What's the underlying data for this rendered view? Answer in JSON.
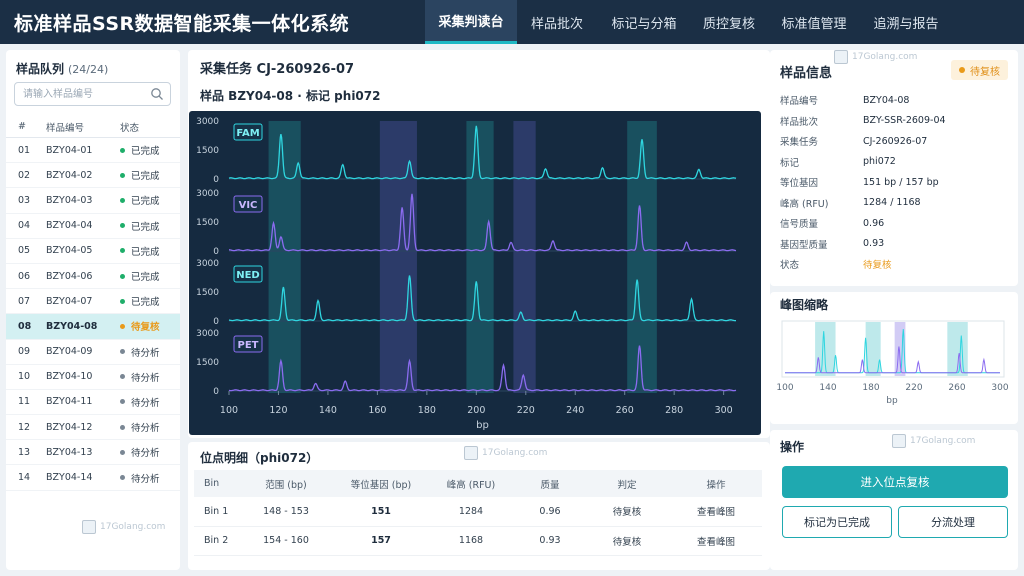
{
  "app": {
    "title": "标准样品SSR数据智能采集一体化系统"
  },
  "nav": [
    {
      "label": "采集判读台",
      "active": true
    },
    {
      "label": "样品批次",
      "active": false
    },
    {
      "label": "标记与分箱",
      "active": false
    },
    {
      "label": "质控复核",
      "active": false
    },
    {
      "label": "标准值管理",
      "active": false
    },
    {
      "label": "追溯与报告",
      "active": false
    }
  ],
  "queue": {
    "title": "样品队列",
    "count": "(24/24)",
    "search_placeholder": "请输入样品编号",
    "columns": [
      "#",
      "样品编号",
      "状态"
    ],
    "rows": [
      {
        "idx": "01",
        "id": "BZY04-01",
        "status": "已完成",
        "color": "#1fae6a"
      },
      {
        "idx": "02",
        "id": "BZY04-02",
        "status": "已完成",
        "color": "#1fae6a"
      },
      {
        "idx": "03",
        "id": "BZY04-03",
        "status": "已完成",
        "color": "#1fae6a"
      },
      {
        "idx": "04",
        "id": "BZY04-04",
        "status": "已完成",
        "color": "#1fae6a"
      },
      {
        "idx": "05",
        "id": "BZY04-05",
        "status": "已完成",
        "color": "#1fae6a"
      },
      {
        "idx": "06",
        "id": "BZY04-06",
        "status": "已完成",
        "color": "#1fae6a"
      },
      {
        "idx": "07",
        "id": "BZY04-07",
        "status": "已完成",
        "color": "#1fae6a"
      },
      {
        "idx": "08",
        "id": "BZY04-08",
        "status": "待复核",
        "color": "#e99a1a",
        "selected": true
      },
      {
        "idx": "09",
        "id": "BZY04-09",
        "status": "待分析",
        "color": "#7a8794"
      },
      {
        "idx": "10",
        "id": "BZY04-10",
        "status": "待分析",
        "color": "#7a8794"
      },
      {
        "idx": "11",
        "id": "BZY04-11",
        "status": "待分析",
        "color": "#7a8794"
      },
      {
        "idx": "12",
        "id": "BZY04-12",
        "status": "待分析",
        "color": "#7a8794"
      },
      {
        "idx": "13",
        "id": "BZY04-13",
        "status": "待分析",
        "color": "#7a8794"
      },
      {
        "idx": "14",
        "id": "BZY04-14",
        "status": "待分析",
        "color": "#7a8794"
      }
    ]
  },
  "task": {
    "title": "采集任务  CJ-260926-07",
    "sample_line": "样品  BZY04-08  ·  标记 phi072"
  },
  "chart_data": {
    "type": "line",
    "xlabel": "bp",
    "xlim": [
      100,
      305
    ],
    "xticks": [
      100,
      120,
      140,
      160,
      180,
      200,
      220,
      240,
      260,
      280,
      300
    ],
    "yticks": [
      0,
      1500,
      3000
    ],
    "ylim": [
      0,
      3000
    ],
    "highlight_bands": [
      [
        116,
        129
      ],
      [
        161,
        176
      ],
      [
        196,
        207
      ],
      [
        215,
        224
      ],
      [
        261,
        273
      ]
    ],
    "channels": [
      {
        "name": "FAM",
        "color": "#2fd6e0",
        "peaks": [
          [
            121,
            2300
          ],
          [
            128,
            800
          ],
          [
            146,
            700
          ],
          [
            173,
            900
          ],
          [
            200,
            2700
          ],
          [
            228,
            500
          ],
          [
            251,
            550
          ],
          [
            267,
            2000
          ],
          [
            290,
            450
          ]
        ]
      },
      {
        "name": "VIC",
        "color": "#8b6cf0",
        "peaks": [
          [
            118,
            1400
          ],
          [
            121,
            700
          ],
          [
            170,
            2200
          ],
          [
            174,
            2900
          ],
          [
            205,
            1500
          ],
          [
            214,
            400
          ],
          [
            231,
            500
          ],
          [
            266,
            2300
          ],
          [
            285,
            400
          ]
        ]
      },
      {
        "name": "NED",
        "color": "#2fd6e0",
        "peaks": [
          [
            122,
            1700
          ],
          [
            136,
            1000
          ],
          [
            173,
            2300
          ],
          [
            200,
            2000
          ],
          [
            218,
            400
          ],
          [
            240,
            450
          ],
          [
            265,
            2100
          ],
          [
            287,
            1100
          ]
        ]
      },
      {
        "name": "PET",
        "color": "#8b6cf0",
        "peaks": [
          [
            121,
            1500
          ],
          [
            135,
            350
          ],
          [
            147,
            450
          ],
          [
            173,
            1500
          ],
          [
            211,
            1300
          ],
          [
            219,
            800
          ],
          [
            266,
            2300
          ]
        ]
      }
    ]
  },
  "detail": {
    "title": "位点明细（phi072）",
    "columns": [
      "Bin",
      "范围 (bp)",
      "等位基因 (bp)",
      "峰高 (RFU)",
      "质量",
      "判定",
      "操作"
    ],
    "rows": [
      {
        "bin": "Bin 1",
        "range": "148 - 153",
        "allele": "151",
        "height": "1284",
        "quality": "0.96",
        "verdict": "待复核",
        "action": "查看峰图"
      },
      {
        "bin": "Bin 2",
        "range": "154 - 160",
        "allele": "157",
        "height": "1168",
        "quality": "0.93",
        "verdict": "待复核",
        "action": "查看峰图"
      }
    ]
  },
  "info": {
    "title": "样品信息",
    "badge": "待复核",
    "rows": [
      {
        "k": "样品编号",
        "v": "BZY04-08"
      },
      {
        "k": "样品批次",
        "v": "BZY-SSR-2609-04"
      },
      {
        "k": "采集任务",
        "v": "CJ-260926-07"
      },
      {
        "k": "标记",
        "v": "phi072"
      },
      {
        "k": "等位基因",
        "v": "151 bp / 157 bp"
      },
      {
        "k": "峰高 (RFU)",
        "v": "1284 / 1168"
      },
      {
        "k": "信号质量",
        "v": "0.96"
      },
      {
        "k": "基因型质量",
        "v": "0.93"
      },
      {
        "k": "状态",
        "v": "待复核"
      }
    ]
  },
  "thumbnail": {
    "title": "峰图缩略",
    "xticks": [
      100,
      140,
      180,
      220,
      260,
      300
    ],
    "xlabel": "bp"
  },
  "ops": {
    "title": "操作",
    "primary": "进入位点复核",
    "mark_done": "标记为已完成",
    "split": "分流处理"
  },
  "watermark": "17Golang.com",
  "colors": {
    "accent": "#1fa9b0",
    "nav_bg": "#1b2f45",
    "chart_bg": "#152a40",
    "pending": "#e99a1a",
    "done": "#1fae6a"
  }
}
